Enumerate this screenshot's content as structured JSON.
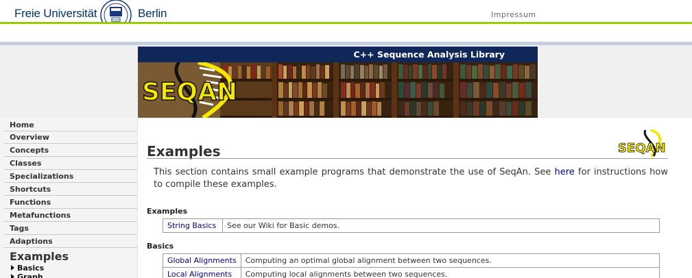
{
  "header": {
    "university_left": "Freie Universität",
    "university_right": "Berlin",
    "impressum": "Impressum"
  },
  "banner": {
    "title": "C++ Sequence Analysis Library",
    "logo_text": "SEQAN"
  },
  "sidebar": {
    "items": [
      {
        "label": "Home"
      },
      {
        "label": "Overview"
      },
      {
        "label": "Concepts"
      },
      {
        "label": "Classes"
      },
      {
        "label": "Specializations"
      },
      {
        "label": "Shortcuts"
      },
      {
        "label": "Functions"
      },
      {
        "label": "Metafunctions"
      },
      {
        "label": "Tags"
      },
      {
        "label": "Adaptions"
      }
    ],
    "heading": "Examples",
    "subitems": [
      {
        "label": "Basics"
      },
      {
        "label": "Graph"
      }
    ]
  },
  "main": {
    "title": "Examples",
    "corner_logo_text": "SEQAN",
    "intro_before": "This section contains small example programs that demonstrate the use of SeqAn. See ",
    "intro_link": "here",
    "intro_after": " for instructions how to compile these examples.",
    "sections": [
      {
        "heading": "Examples",
        "rows": [
          {
            "link": "String Basics",
            "desc": "See our Wiki for Basic demos."
          }
        ]
      },
      {
        "heading": "Basics",
        "rows": [
          {
            "link": "Global Alignments",
            "desc": "Computing an optimal global alignment between two sequences."
          },
          {
            "link": "Local Alignments",
            "desc": "Computing local alignments between two sequences."
          }
        ]
      }
    ]
  },
  "colors": {
    "accent_green": "#99cc00",
    "banner_navy": "#10275a",
    "link_blue": "#000088",
    "logo_yellow": "#f5e800"
  }
}
